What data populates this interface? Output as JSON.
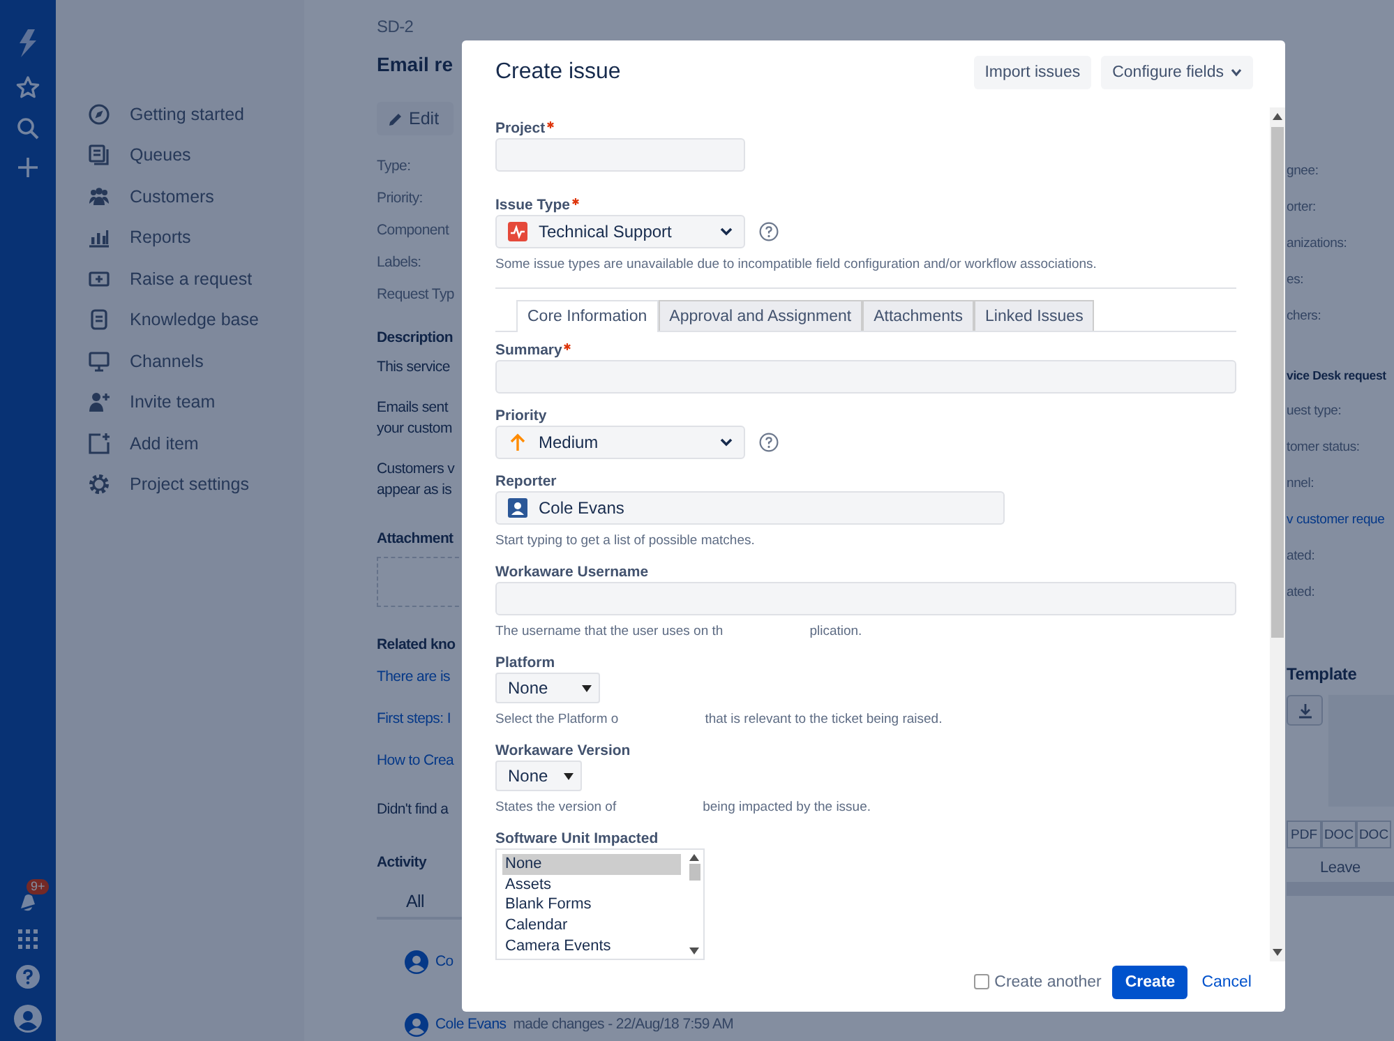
{
  "global_nav": {
    "notification_badge": "9+"
  },
  "sidebar": {
    "items": [
      {
        "label": "Getting started"
      },
      {
        "label": "Queues"
      },
      {
        "label": "Customers"
      },
      {
        "label": "Reports"
      },
      {
        "label": "Raise a request"
      },
      {
        "label": "Knowledge base"
      },
      {
        "label": "Channels"
      },
      {
        "label": "Invite team"
      },
      {
        "label": "Add item"
      },
      {
        "label": "Project settings"
      }
    ]
  },
  "issue": {
    "key": "SD-2",
    "title": "Email re",
    "edit_button": "Edit",
    "fields": [
      "Type:",
      "Priority:",
      "Component",
      "Labels:",
      "Request Typ"
    ],
    "description": {
      "heading": "Description",
      "paragraphs": [
        [
          "This service"
        ],
        [
          "Emails sent",
          "your custom"
        ],
        [
          "Customers v",
          "appear as is"
        ]
      ]
    },
    "attachments_heading": "Attachment",
    "related": {
      "heading": "Related kno",
      "links": [
        "There are is",
        "First steps: I",
        "How to Crea"
      ],
      "footer": "Didn't find a"
    },
    "activity": {
      "heading": "Activity",
      "tab": "All",
      "entries": [
        {
          "author": "Co"
        },
        {
          "author": "Cole Evans",
          "text": "made changes - 22/Aug/18 7:59 AM"
        }
      ]
    }
  },
  "details": {
    "items": [
      {
        "kind": "label",
        "text": "gnee:"
      },
      {
        "kind": "label",
        "text": "orter:"
      },
      {
        "kind": "label",
        "text": "anizations:"
      },
      {
        "kind": "label",
        "text": "es:"
      },
      {
        "kind": "label",
        "text": "chers:"
      },
      {
        "kind": "heading",
        "text": "vice Desk request"
      },
      {
        "kind": "label",
        "text": "uest type:"
      },
      {
        "kind": "label",
        "text": "tomer status:"
      },
      {
        "kind": "label",
        "text": "nnel:"
      },
      {
        "kind": "link",
        "text": "v customer reque"
      },
      {
        "kind": "label",
        "text": "ated:"
      },
      {
        "kind": "label",
        "text": "ated:"
      }
    ],
    "template": {
      "heading": "Template",
      "formats": [
        "PDF",
        "DOC",
        "DOC"
      ],
      "action": "Leave"
    }
  },
  "modal": {
    "title": "Create issue",
    "header_buttons": [
      "Import issues",
      "Configure fields"
    ],
    "top_fields": [
      {
        "kind": "project",
        "label": "Project",
        "required": true
      },
      {
        "kind": "issuetype",
        "label": "Issue Type",
        "required": true,
        "value": "Technical Support",
        "help": true,
        "hint": [
          "Some issue types are unavailable due to incompatible field configuration and/or workflow associations."
        ]
      }
    ],
    "tabs": [
      {
        "label": "Core Information",
        "selected": true
      },
      {
        "label": "Approval and Assignment",
        "selected": false
      },
      {
        "label": "Attachments",
        "selected": false
      },
      {
        "label": "Linked Issues",
        "selected": false
      }
    ],
    "tab_fields": [
      {
        "kind": "text",
        "label": "Summary",
        "required": true
      },
      {
        "kind": "priority",
        "label": "Priority",
        "required": false,
        "value": "Medium",
        "help": true
      },
      {
        "kind": "user",
        "label": "Reporter",
        "required": false,
        "value": "Cole Evans",
        "hint": [
          "Start typing to get a list of possible matches."
        ]
      },
      {
        "kind": "text",
        "label": "Workaware Username",
        "required": false,
        "hint": [
          "The username that the user uses on th",
          "plication."
        ]
      },
      {
        "kind": "native-select",
        "label": "Platform",
        "required": false,
        "value": "None",
        "hint": [
          "Select the Platform o",
          "that is relevant to the ticket being raised."
        ]
      },
      {
        "kind": "native-select-narrow",
        "label": "Workaware Version",
        "required": false,
        "value": "None",
        "hint": [
          "States the version of",
          "being impacted by the issue."
        ]
      },
      {
        "kind": "listbox",
        "label": "Software Unit Impacted",
        "required": false,
        "options": [
          {
            "label": "None",
            "selected": true
          },
          {
            "label": "Assets",
            "selected": false
          },
          {
            "label": "Blank Forms",
            "selected": false
          },
          {
            "label": "Calendar",
            "selected": false
          },
          {
            "label": "Camera Events",
            "selected": false
          }
        ]
      }
    ],
    "create_another": {
      "label": "Create another",
      "checked": false
    },
    "create_button": "Create",
    "cancel_link": "Cancel"
  }
}
